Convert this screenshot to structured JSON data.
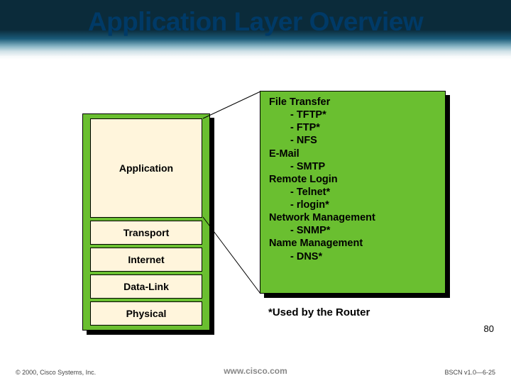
{
  "title": "Application Layer Overview",
  "layers": {
    "l1": "Application",
    "l2": "Transport",
    "l3": "Internet",
    "l4": "Data-Link",
    "l5": "Physical"
  },
  "callout": {
    "categories": [
      {
        "label": "File Transfer",
        "items": [
          "- TFTP*",
          "- FTP*",
          "- NFS"
        ]
      },
      {
        "label": "E-Mail",
        "items": [
          "- SMTP"
        ]
      },
      {
        "label": "Remote Login",
        "items": [
          "- Telnet*",
          "- rlogin*"
        ]
      },
      {
        "label": "Network Management",
        "items": [
          "- SNMP*"
        ]
      },
      {
        "label": "Name Management",
        "items": [
          "- DNS*"
        ]
      }
    ]
  },
  "footnote": "*Used by the Router",
  "page_number": "80",
  "footer": {
    "left": "© 2000, Cisco Systems, Inc.",
    "center": "www.cisco.com",
    "right": "BSCN v1.0—6-25"
  },
  "chart_data": {
    "type": "table",
    "title": "Application Layer Overview",
    "model": "TCP/IP layer model with Application-layer protocol examples",
    "layers_top_to_bottom": [
      "Application",
      "Transport",
      "Internet",
      "Data-Link",
      "Physical"
    ],
    "application_layer_protocols": [
      {
        "category": "File Transfer",
        "protocols": [
          "TFTP",
          "FTP",
          "NFS"
        ],
        "used_by_router": [
          "TFTP",
          "FTP"
        ]
      },
      {
        "category": "E-Mail",
        "protocols": [
          "SMTP"
        ],
        "used_by_router": []
      },
      {
        "category": "Remote Login",
        "protocols": [
          "Telnet",
          "rlogin"
        ],
        "used_by_router": [
          "Telnet",
          "rlogin"
        ]
      },
      {
        "category": "Network Management",
        "protocols": [
          "SNMP"
        ],
        "used_by_router": [
          "SNMP"
        ]
      },
      {
        "category": "Name Management",
        "protocols": [
          "DNS"
        ],
        "used_by_router": [
          "DNS"
        ]
      }
    ],
    "asterisk_meaning": "Used by the Router"
  }
}
